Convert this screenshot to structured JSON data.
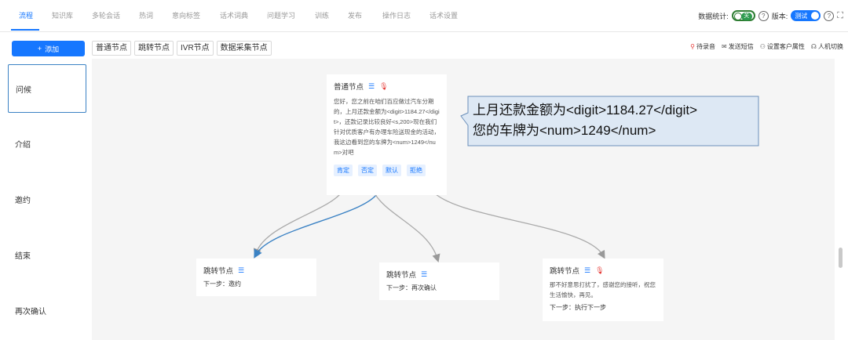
{
  "top_tabs": [
    {
      "label": "流程",
      "active": true
    },
    {
      "label": "知识库"
    },
    {
      "label": "多轮会话"
    },
    {
      "label": "热词"
    },
    {
      "label": "意向标签"
    },
    {
      "label": "话术词典"
    },
    {
      "label": "问题学习"
    },
    {
      "label": "训练"
    },
    {
      "label": "发布"
    },
    {
      "label": "操作日志"
    },
    {
      "label": "话术设置"
    }
  ],
  "header_right": {
    "stats_label": "数据统计:",
    "stats_toggle": "关",
    "version_label": "版本:",
    "version_toggle": "测试",
    "help_glyph": "?",
    "expand_glyph": "⛶"
  },
  "add_button": {
    "icon": "+",
    "label": "添加"
  },
  "node_types": [
    "普通节点",
    "跳转节点",
    "IVR节点",
    "数据采集节点"
  ],
  "actions": [
    {
      "icon": "pin-icon",
      "glyph": "⚲",
      "label": "待录音"
    },
    {
      "icon": "sms-icon",
      "glyph": "✉",
      "label": "发送短信"
    },
    {
      "icon": "user-attr-icon",
      "glyph": "⚇",
      "label": "设置客户属性"
    },
    {
      "icon": "headset-icon",
      "glyph": "☊",
      "label": "人机切换"
    }
  ],
  "sidebar": [
    {
      "label": "问候",
      "active": true
    },
    {
      "label": "介绍"
    },
    {
      "label": "邀约"
    },
    {
      "label": "结束"
    },
    {
      "label": "再次确认"
    }
  ],
  "main_node": {
    "title": "普通节点",
    "body": "您好，您之前在咱们百应做过汽车分期的，上月还款金额为<digit>1184.27</digit>，还款记录比较良好<s,200>现在我们针对优质客户有办理车险送现金的活动，我这边看到您的车牌为<num>1249</num>对吧",
    "chips": [
      "肯定",
      "否定",
      "默认",
      "拒绝"
    ]
  },
  "callout": {
    "line1": "上月还款金额为<digit>1184.27</digit>",
    "line2": "您的车牌为<num>1249</num>"
  },
  "jump_nodes": [
    {
      "title": "跳转节点",
      "next": "下一步：邀约"
    },
    {
      "title": "跳转节点",
      "next": "下一步：再次确认"
    },
    {
      "title": "跳转节点",
      "body": "那不好意思打扰了，感谢您的接听，祝您生活愉快，再见。",
      "next": "下一步：执行下一步"
    }
  ],
  "colors": {
    "accent": "#1677ff",
    "mic": "#e53935",
    "toggle_green": "#2e9b4f"
  }
}
